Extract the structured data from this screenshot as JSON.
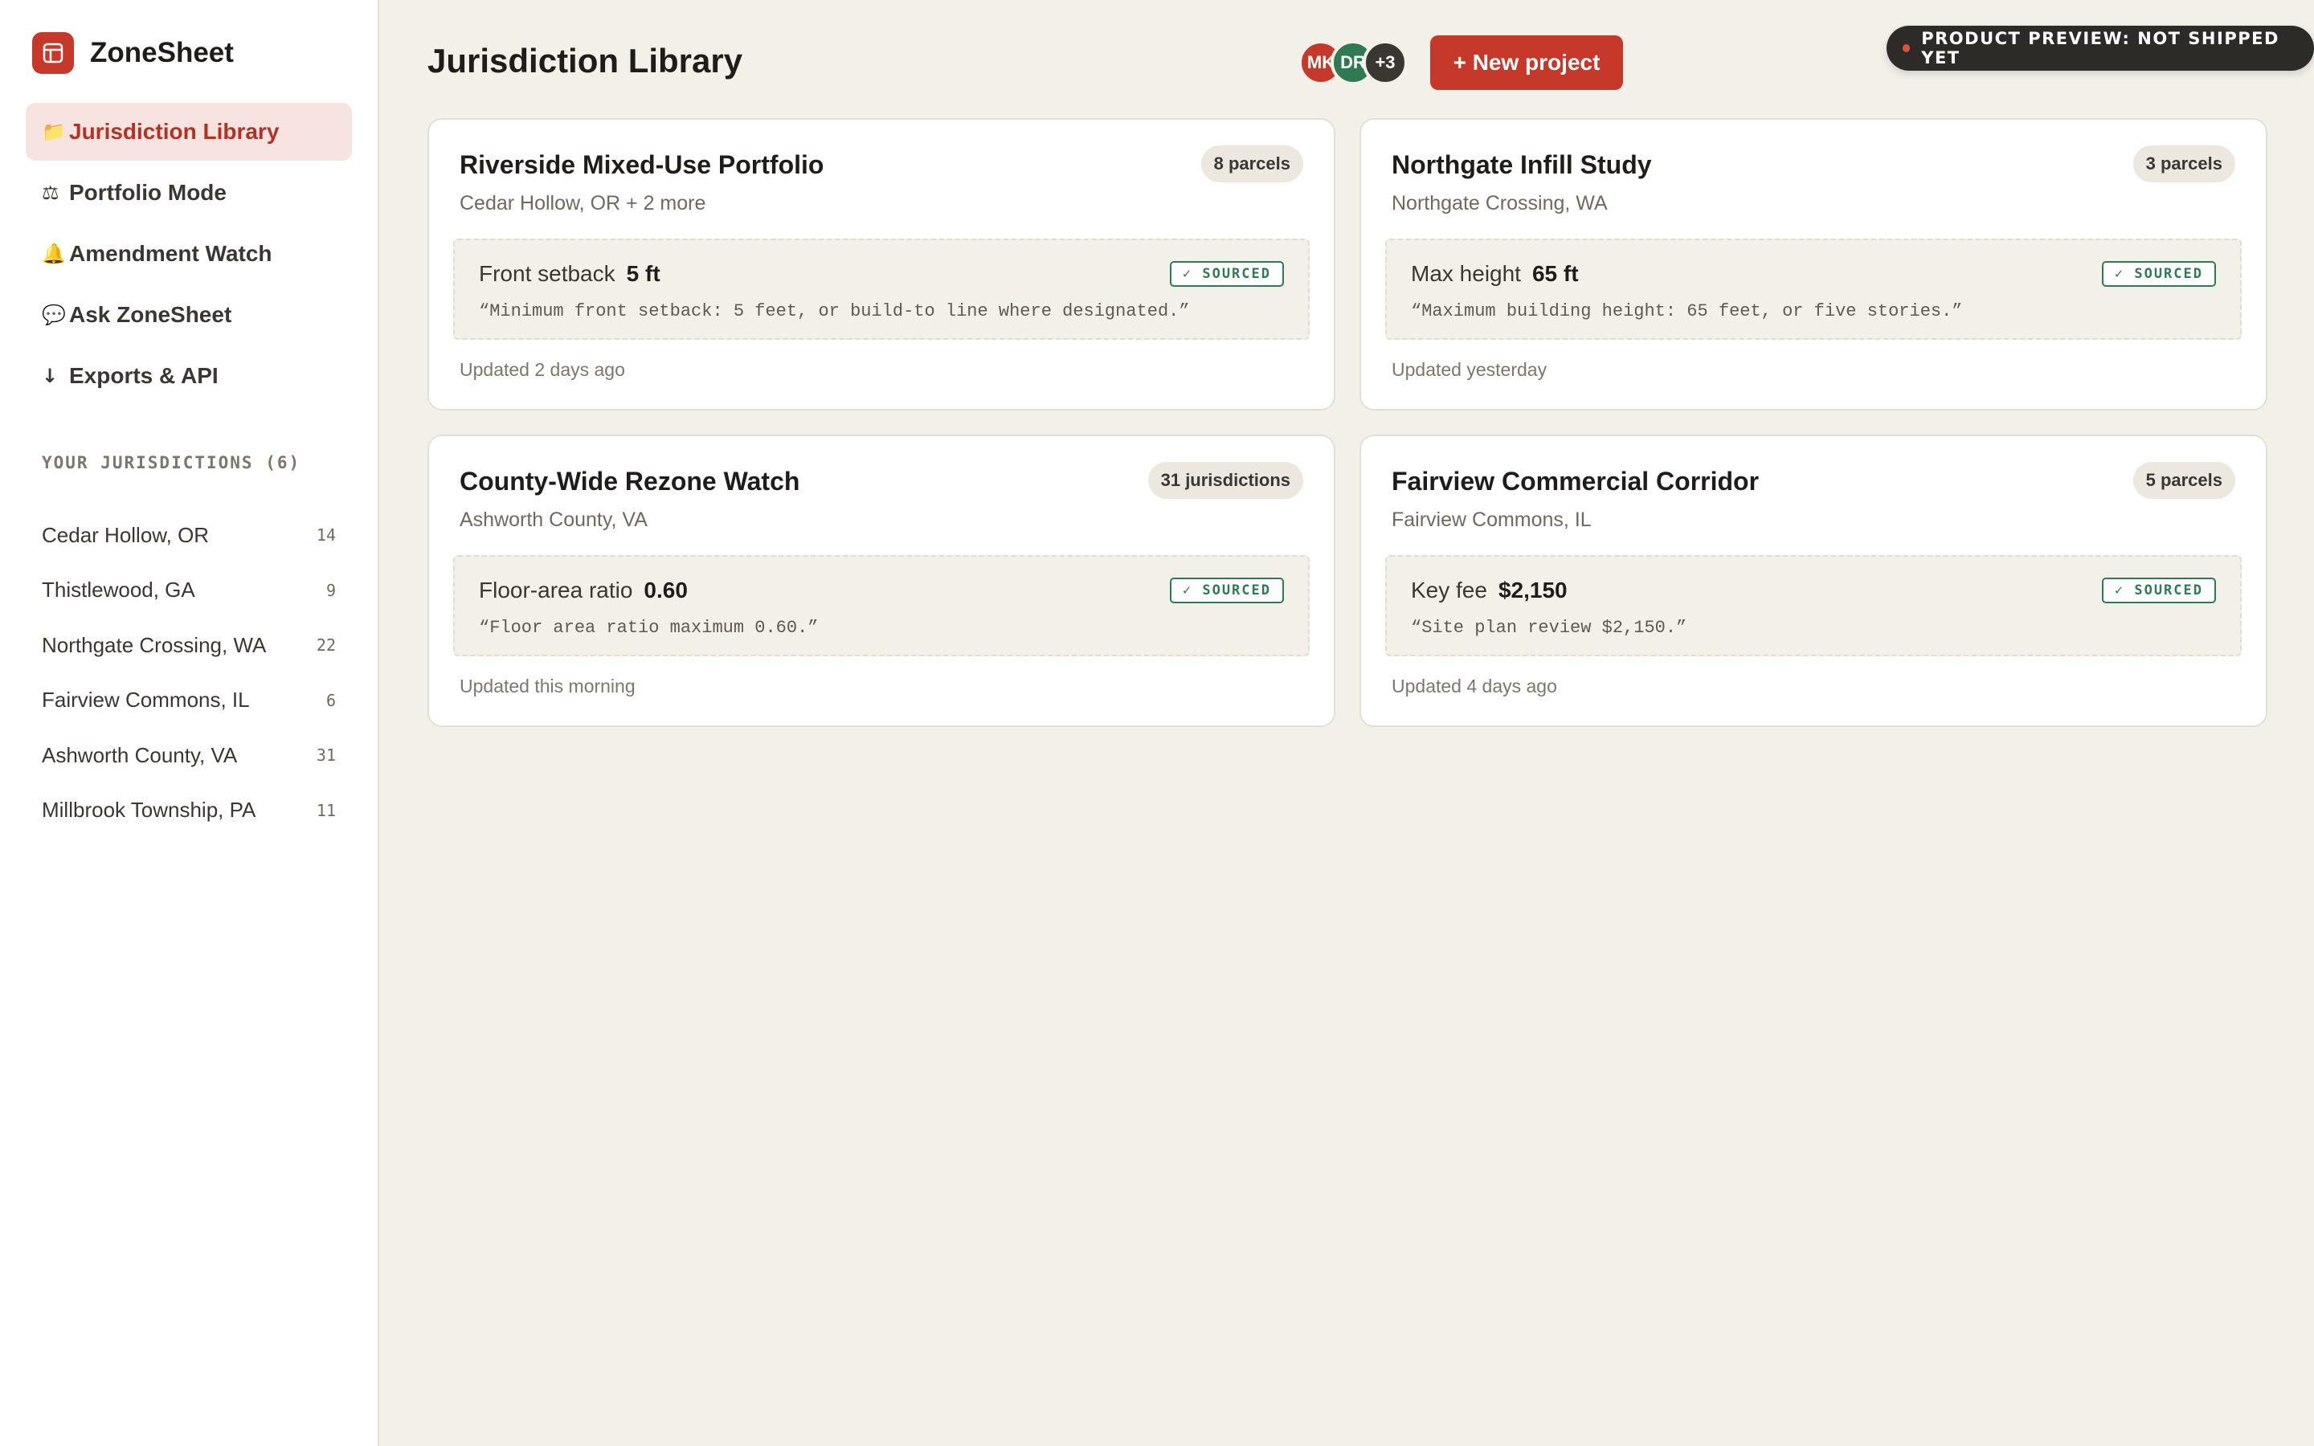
{
  "app": {
    "name": "ZoneSheet",
    "accent_color": "#c6392a"
  },
  "sidebar": {
    "nav": [
      {
        "icon": "folder-icon",
        "glyph": "📁",
        "label": "Jurisdiction Library",
        "active": true
      },
      {
        "icon": "scales-icon",
        "glyph": "⚖",
        "label": "Portfolio Mode",
        "active": false
      },
      {
        "icon": "bell-icon",
        "glyph": "🔔",
        "label": "Amendment Watch",
        "active": false
      },
      {
        "icon": "chat-icon",
        "glyph": "💬",
        "label": "Ask ZoneSheet",
        "active": false
      },
      {
        "icon": "download-arrow-icon",
        "glyph": "↓",
        "label": "Exports & API",
        "active": false
      }
    ],
    "section_title": "YOUR JURISDICTIONS (6)",
    "jurisdictions": [
      {
        "name": "Cedar Hollow, OR",
        "count": "14"
      },
      {
        "name": "Thistlewood, GA",
        "count": "9"
      },
      {
        "name": "Northgate Crossing, WA",
        "count": "22"
      },
      {
        "name": "Fairview Commons, IL",
        "count": "6"
      },
      {
        "name": "Ashworth County, VA",
        "count": "31"
      },
      {
        "name": "Millbrook Township, PA",
        "count": "11"
      }
    ]
  },
  "header": {
    "title": "Jurisdiction Library",
    "avatars": [
      {
        "initials": "MK",
        "color": "#c6392a"
      },
      {
        "initials": "DR",
        "color": "#2f7a52"
      },
      {
        "initials": "+3",
        "color": "#3a3733"
      }
    ],
    "new_project_label": "+ New project",
    "preview_label": "PRODUCT PREVIEW: NOT SHIPPED YET"
  },
  "cards": [
    {
      "title": "Riverside Mixed-Use Portfolio",
      "subtitle": "Cedar Hollow, OR + 2 more",
      "badge": "8 parcels",
      "rule_label": "Front setback",
      "rule_value": "5 ft",
      "sourced_label": "✓ SOURCED",
      "quote": "“Minimum front setback: 5 feet, or build-to line where designated.”",
      "updated": "Updated 2 days ago"
    },
    {
      "title": "Northgate Infill Study",
      "subtitle": "Northgate Crossing, WA",
      "badge": "3 parcels",
      "rule_label": "Max height",
      "rule_value": "65 ft",
      "sourced_label": "✓ SOURCED",
      "quote": "“Maximum building height: 65 feet, or five stories.”",
      "updated": "Updated yesterday"
    },
    {
      "title": "County-Wide Rezone Watch",
      "subtitle": "Ashworth County, VA",
      "badge": "31 jurisdictions",
      "rule_label": "Floor-area ratio",
      "rule_value": "0.60",
      "sourced_label": "✓ SOURCED",
      "quote": "“Floor area ratio maximum 0.60.”",
      "updated": "Updated this morning"
    },
    {
      "title": "Fairview Commercial Corridor",
      "subtitle": "Fairview Commons, IL",
      "badge": "5 parcels",
      "rule_label": "Key fee",
      "rule_value": "$2,150",
      "sourced_label": "✓ SOURCED",
      "quote": "“Site plan review $2,150.”",
      "updated": "Updated 4 days ago"
    }
  ]
}
